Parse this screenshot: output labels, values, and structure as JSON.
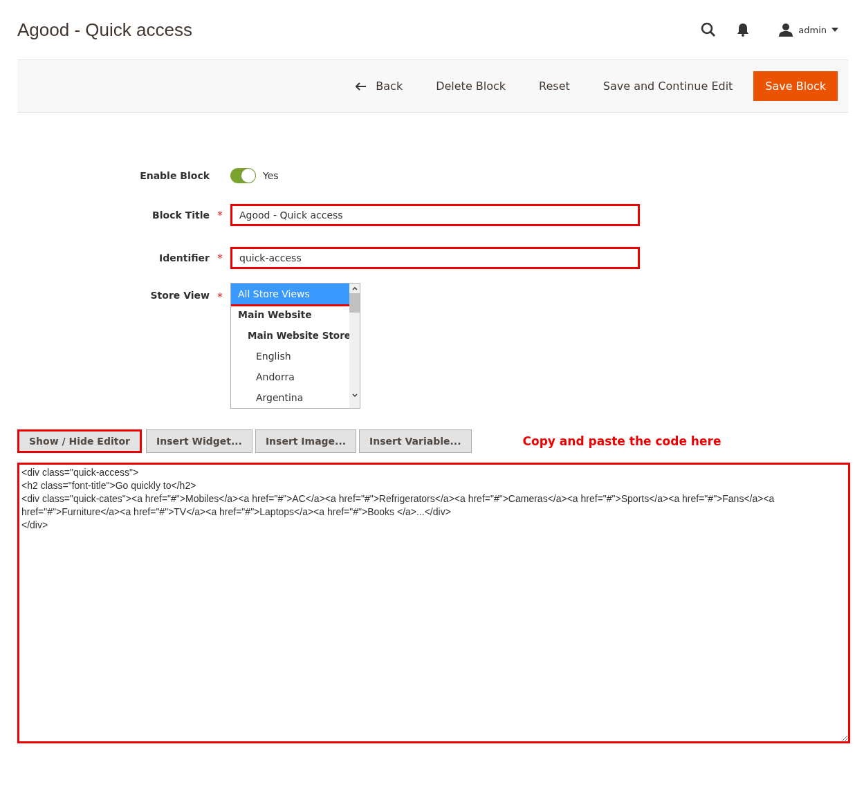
{
  "page_title": "Agood - Quick access",
  "header": {
    "user": "admin"
  },
  "actions": [
    {
      "label": "Back",
      "kind": "back"
    },
    {
      "label": "Delete Block",
      "kind": "plain"
    },
    {
      "label": "Reset",
      "kind": "plain"
    },
    {
      "label": "Save and Continue Edit",
      "kind": "plain"
    },
    {
      "label": "Save Block",
      "kind": "primary"
    }
  ],
  "form": {
    "enable": {
      "label": "Enable Block",
      "on": true,
      "value_label": "Yes"
    },
    "fields": [
      {
        "label": "Block Title",
        "required_mark": "*",
        "value": "Agood - Quick access",
        "highlighted": true
      },
      {
        "label": "Identifier",
        "required_mark": "*",
        "value": "quick-access",
        "highlighted": true
      }
    ],
    "store_view": {
      "label": "Store View",
      "required_mark": "*",
      "options": [
        {
          "label": "All Store Views",
          "kind": "option",
          "selected": true,
          "highlighted": true
        },
        {
          "label": "Main Website",
          "kind": "website",
          "selected": false,
          "highlighted": false
        },
        {
          "label": "Main Website Store",
          "kind": "store",
          "selected": false,
          "highlighted": false
        },
        {
          "label": "English",
          "kind": "view",
          "selected": false,
          "highlighted": false
        },
        {
          "label": "Andorra",
          "kind": "view",
          "selected": false,
          "highlighted": false
        },
        {
          "label": "Argentina",
          "kind": "view",
          "selected": false,
          "highlighted": false
        }
      ]
    }
  },
  "editor": {
    "buttons": [
      {
        "label": "Show / Hide Editor",
        "highlighted": true
      },
      {
        "label": "Insert Widget...",
        "highlighted": false
      },
      {
        "label": "Insert Image...",
        "highlighted": false
      },
      {
        "label": "Insert Variable...",
        "highlighted": false
      }
    ],
    "note": "Copy and paste the code here",
    "content": "<div class=\"quick-access\">\n<h2 class=\"font-title\">Go quickly to</h2>\n<div class=\"quick-cates\"><a href=\"#\">Mobiles</a><a href=\"#\">AC</a><a href=\"#\">Refrigerators</a><a href=\"#\">Cameras</a><a href=\"#\">Sports</a><a href=\"#\">Fans</a><a href=\"#\">Furniture</a><a href=\"#\">TV</a><a href=\"#\">Laptops</a><a href=\"#\">Books </a>...</div>\n</div>",
    "highlighted": true
  }
}
